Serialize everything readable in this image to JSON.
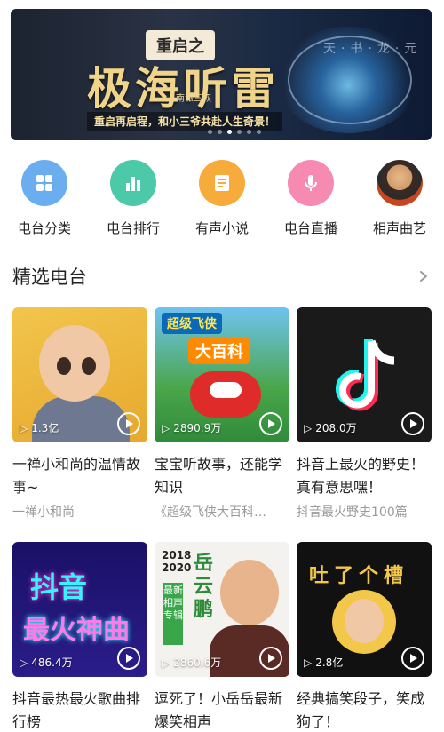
{
  "banner": {
    "tag": "重启之",
    "headline": "极海听雷",
    "stamp": "南派三叔",
    "tagline": "重启再启程，和小三爷共赴人生奇景！",
    "corner_text": "天·书·龙·元",
    "dots": 6,
    "active_dot": 3
  },
  "categories": [
    {
      "label": "电台分类",
      "icon": "grid-icon",
      "color": "#6aaef0"
    },
    {
      "label": "电台排行",
      "icon": "bar-chart-icon",
      "color": "#4cc9a8"
    },
    {
      "label": "有声小说",
      "icon": "book-icon",
      "color": "#f6ab3a"
    },
    {
      "label": "电台直播",
      "icon": "microphone-icon",
      "color": "#f78ab0"
    },
    {
      "label": "相声曲艺",
      "icon": "performer-avatar-icon",
      "color": "#c24a22"
    }
  ],
  "section": {
    "title": "精选电台"
  },
  "cards": [
    {
      "plays": "1.3亿",
      "title": "一禅小和尚的温情故事~",
      "sub": "一禅小和尚"
    },
    {
      "plays": "2890.9万",
      "title": "宝宝听故事，还能学知识",
      "sub": "《超级飞侠大百科…"
    },
    {
      "plays": "208.0万",
      "title": "抖音上最火的野史！真有意思嘿！",
      "sub": "抖音最火野史100篇"
    },
    {
      "plays": "486.4万",
      "title": "抖音最热最火歌曲排行榜",
      "sub": ""
    },
    {
      "plays": "2860.6万",
      "title": "逗死了！小岳岳最新爆笑相声",
      "sub": ""
    },
    {
      "plays": "2.8亿",
      "title": "经典搞笑段子，笑成狗了！",
      "sub": ""
    }
  ],
  "thumb_text": {
    "jets_1": "超级飞侠",
    "jets_2": "大百科",
    "hits_1": "抖音",
    "hits_2": "最火神曲",
    "yue_years": "2018\n2020",
    "yue_name": "岳云鹏",
    "yue_box": "最新相声专辑",
    "tucao": "吐了个槽"
  }
}
